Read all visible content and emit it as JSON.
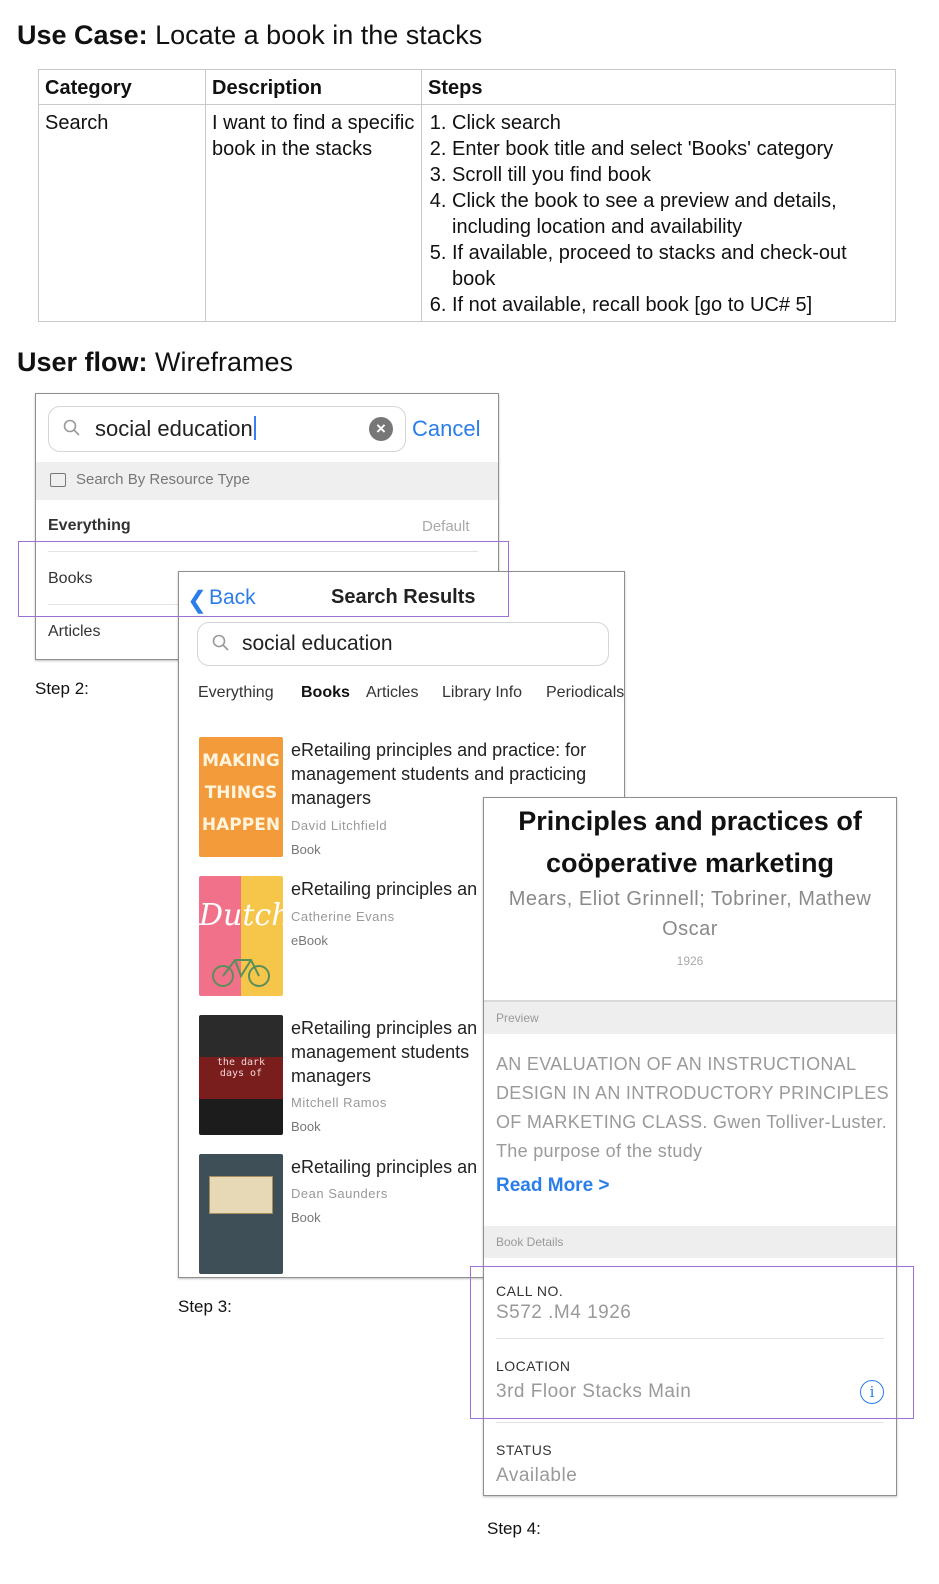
{
  "use_case": {
    "label": "Use Case:",
    "text": "Locate a book in the stacks",
    "table": {
      "headers": [
        "Category",
        "Description",
        "Steps"
      ],
      "category": "Search",
      "description": "I want to find a specific book in the stacks",
      "steps": [
        "Click search",
        "Enter book title and select 'Books' category",
        "Scroll till you find book",
        "Click the book to see a preview and details, including location and availability",
        "If available, proceed to stacks and check-out book",
        "If not available, recall book [go to UC# 5]"
      ]
    }
  },
  "user_flow": {
    "label": "User flow:",
    "text": "Wireframes"
  },
  "step2": {
    "caption": "Step 2:",
    "search_value": "social education",
    "cancel_label": "Cancel",
    "resource_type_label": "Search By Resource Type",
    "options": [
      {
        "label": "Everything",
        "note": "Default"
      },
      {
        "label": "Books",
        "note": ""
      },
      {
        "label": "Articles",
        "note": ""
      }
    ]
  },
  "step3": {
    "caption": "Step 3:",
    "back_label": "Back",
    "title": "Search Results",
    "search_value": "social education",
    "tabs": [
      "Everything",
      "Books",
      "Articles",
      "Library Info",
      "Periodicals"
    ],
    "active_tab": "Books",
    "results": [
      {
        "title": "eRetailing principles and practice: for management students and practicing managers",
        "author": "David Litchfield",
        "type": "Book",
        "cover_text": [
          "MAKING",
          "THINGS",
          "HAPPEN"
        ]
      },
      {
        "title": "eRetailing principles an",
        "author": "Catherine Evans",
        "type": "eBook",
        "cover_text": [
          "Dutch"
        ]
      },
      {
        "title": "eRetailing principles an management students managers",
        "author": "Mitchell Ramos",
        "type": "Book",
        "cover_text": [
          "the dark",
          "days of"
        ]
      },
      {
        "title": "eRetailing principles an",
        "author": "Dean Saunders",
        "type": "Book",
        "cover_text": []
      }
    ]
  },
  "step4": {
    "caption": "Step 4:",
    "title": "Principles and practices of coöperative marketing",
    "authors": "Mears, Eliot Grinnell; Tobriner, Mathew Oscar",
    "year": "1926",
    "preview_label": "Preview",
    "preview_text": "AN EVALUATION OF AN INSTRUCTIONAL DESIGN IN AN INTRODUCTORY PRINCIPLES OF MARKETING CLASS. Gwen Tolliver-Luster. The purpose of the study",
    "read_more": "Read More >",
    "details_label": "Book Details",
    "call_no_label": "CALL NO.",
    "call_no": "S572 .M4 1926",
    "location_label": "LOCATION",
    "location": "3rd Floor Stacks Main",
    "status_label": "STATUS",
    "status": "Available"
  },
  "colors": {
    "link": "#2b7de9",
    "highlight": "#9b72d4"
  }
}
